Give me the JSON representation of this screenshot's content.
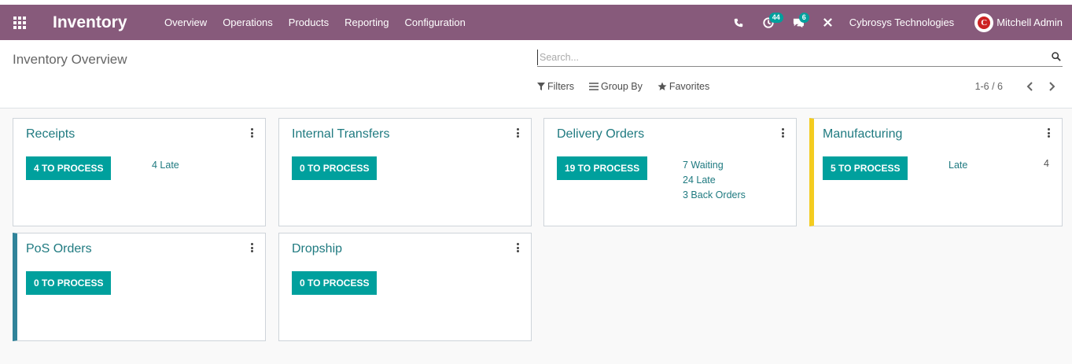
{
  "navbar": {
    "app_name": "Inventory",
    "menu": [
      "Overview",
      "Operations",
      "Products",
      "Reporting",
      "Configuration"
    ],
    "activity_badge": "44",
    "messages_badge": "6",
    "company": "Cybrosys Technologies",
    "user": "Mitchell Admin",
    "avatar_letter": "C",
    "color": "#875a7b"
  },
  "control_panel": {
    "title": "Inventory Overview",
    "search_placeholder": "Search...",
    "filters_label": "Filters",
    "group_by_label": "Group By",
    "favorites_label": "Favorites",
    "pager": "1-6 / 6"
  },
  "cards": [
    {
      "title": "Receipts",
      "button": "4 TO PROCESS",
      "stats": [
        "4 Late"
      ],
      "late_value": "",
      "accent": ""
    },
    {
      "title": "Internal Transfers",
      "button": "0 TO PROCESS",
      "stats": [],
      "late_value": "",
      "accent": ""
    },
    {
      "title": "Delivery Orders",
      "button": "19 TO PROCESS",
      "stats": [
        "7 Waiting",
        "24 Late",
        "3 Back Orders"
      ],
      "late_value": "",
      "accent": ""
    },
    {
      "title": "Manufacturing",
      "button": "5 TO PROCESS",
      "stats": [
        "Late"
      ],
      "late_value": "4",
      "accent": "#f4cc1f"
    },
    {
      "title": "PoS Orders",
      "button": "0 TO PROCESS",
      "stats": [],
      "late_value": "",
      "accent": "#30849a"
    },
    {
      "title": "Dropship",
      "button": "0 TO PROCESS",
      "stats": [],
      "late_value": "",
      "accent": ""
    }
  ],
  "accent_color": "#00a09d"
}
